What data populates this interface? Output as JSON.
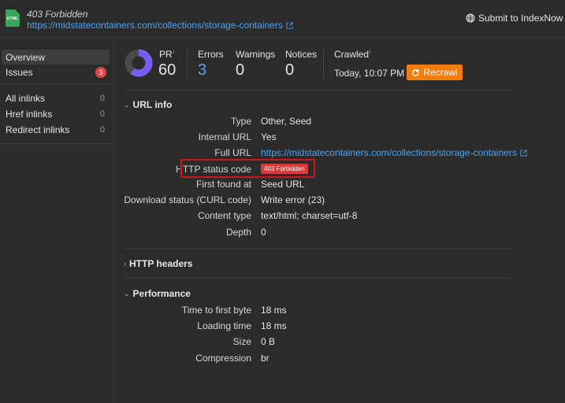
{
  "header": {
    "file_icon_label": "HTML",
    "title": "403 Forbidden",
    "url": "https://midstatecontainers.com/collections/storage-containers",
    "submit_label": "Submit to IndexNow"
  },
  "sidebar": {
    "overview": "Overview",
    "issues": "Issues",
    "issues_count": "3",
    "inlinks": [
      {
        "label": "All inlinks",
        "count": "0"
      },
      {
        "label": "Href inlinks",
        "count": "0"
      },
      {
        "label": "Redirect inlinks",
        "count": "0"
      }
    ]
  },
  "metrics": {
    "pr_label": "PR",
    "pr_value": "60",
    "pr_fraction": 0.6,
    "errors_label": "Errors",
    "errors_value": "3",
    "warnings_label": "Warnings",
    "warnings_value": "0",
    "notices_label": "Notices",
    "notices_value": "0",
    "crawled_label": "Crawled",
    "crawled_value": "Today, 10:07 PM",
    "recrawl_label": "Recrawl"
  },
  "url_info": {
    "section_title": "URL info",
    "rows": [
      {
        "key": "Type",
        "value": "Other, Seed"
      },
      {
        "key": "Internal URL",
        "value": "Yes"
      },
      {
        "key": "Full URL",
        "value": "https://midstatecontainers.com/collections/storage-containers"
      },
      {
        "key": "HTTP status code",
        "value": "403 Forbidden"
      },
      {
        "key": "First found at",
        "value": "Seed URL"
      },
      {
        "key": "Download status (CURL code)",
        "value": "Write error (23)"
      },
      {
        "key": "Content type",
        "value": "text/html; charset=utf-8"
      },
      {
        "key": "Depth",
        "value": "0"
      }
    ]
  },
  "http_headers": {
    "section_title": "HTTP headers"
  },
  "performance": {
    "section_title": "Performance",
    "rows": [
      {
        "key": "Time to first byte",
        "value": "18 ms"
      },
      {
        "key": "Loading time",
        "value": "18 ms"
      },
      {
        "key": "Size",
        "value": "0 B"
      },
      {
        "key": "Compression",
        "value": "br"
      }
    ]
  },
  "colors": {
    "accent_blue": "#4ea3f1",
    "recrawl_orange": "#f07d0e",
    "error_red": "#d93b3b",
    "highlight_red": "#d0151b",
    "donut_purple": "#7b5cf0"
  }
}
